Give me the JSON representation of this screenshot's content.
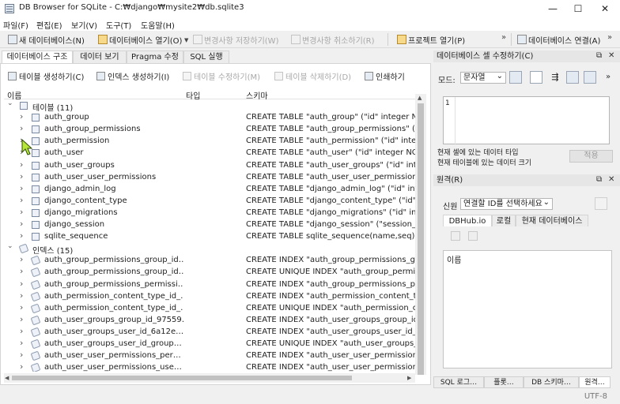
{
  "window": {
    "title": "DB Browser for SQLite - C:₩django₩mysite2₩db.sqlite3",
    "minimize": "—",
    "maximize": "☐",
    "close": "✕"
  },
  "menu": [
    "파일(F)",
    "편집(E)",
    "보기(V)",
    "도구(T)",
    "도움말(H)"
  ],
  "toolbar": {
    "new_db": "새 데이터베이스(N)",
    "open_db": "데이터베이스 열기(O)",
    "write_changes": "변경사항 저장하기(W)",
    "revert_changes": "변경사항 취소하기(R)",
    "open_project": "프로젝트 열기(P)",
    "attach_db": "데이터베이스 연결(A)",
    "more": "»"
  },
  "main_tabs": [
    "데이터베이스 구조",
    "데이터 보기",
    "Pragma 수정",
    "SQL 실행"
  ],
  "structure_toolbar": {
    "create_table": "테이블 생성하기(C)",
    "create_index": "인덱스 생성하기(I)",
    "modify_table": "테이블 수정하기(M)",
    "delete_table": "테이블 삭제하기(D)",
    "print": "인쇄하기"
  },
  "tree": {
    "headers": {
      "name": "이름",
      "type": "타입",
      "schema": "스키마"
    },
    "tables_group": "테이블 (11)",
    "tables": [
      {
        "name": "auth_group",
        "schema": "CREATE TABLE \"auth_group\" (\"id\" integer NOT N"
      },
      {
        "name": "auth_group_permissions",
        "schema": "CREATE TABLE \"auth_group_permissions\" (\"id\""
      },
      {
        "name": "auth_permission",
        "schema": "CREATE TABLE \"auth_permission\" (\"id\" integer"
      },
      {
        "name": "auth_user",
        "schema": "CREATE TABLE \"auth_user\" (\"id\" integer NOT N"
      },
      {
        "name": "auth_user_groups",
        "schema": "CREATE TABLE \"auth_user_groups\" (\"id\" integer"
      },
      {
        "name": "auth_user_user_permissions",
        "schema": "CREATE TABLE \"auth_user_user_permissions"
      },
      {
        "name": "django_admin_log",
        "schema": "CREATE TABLE \"django_admin_log\" (\"id\" integer"
      },
      {
        "name": "django_content_type",
        "schema": "CREATE TABLE \"django_content_type\" (\"id\" integer"
      },
      {
        "name": "django_migrations",
        "schema": "CREATE TABLE \"django_migrations\" (\"id\" inte"
      },
      {
        "name": "django_session",
        "schema": "CREATE TABLE \"django_session\" (\"session_ke"
      },
      {
        "name": "sqlite_sequence",
        "schema": "CREATE TABLE sqlite_sequence(name,seq)"
      }
    ],
    "indexes_group": "인덱스 (15)",
    "indexes": [
      {
        "name": "auth_group_permissions_group_id…",
        "schema": "CREATE INDEX \"auth_group_permissions_gro"
      },
      {
        "name": "auth_group_permissions_group_id…",
        "schema": "CREATE UNIQUE INDEX \"auth_group_permissi"
      },
      {
        "name": "auth_group_permissions_permissi…",
        "schema": "CREATE INDEX \"auth_group_permissions_per"
      },
      {
        "name": "auth_permission_content_type_id_…",
        "schema": "CREATE INDEX \"auth_permission_content_typ"
      },
      {
        "name": "auth_permission_content_type_id_…",
        "schema": "CREATE UNIQUE INDEX \"auth_permission_con"
      },
      {
        "name": "auth_user_groups_group_id_97559…",
        "schema": "CREATE INDEX \"auth_user_groups_group_id_"
      },
      {
        "name": "auth_user_groups_user_id_6a12e…",
        "schema": "CREATE INDEX \"auth_user_groups_user_id_6"
      },
      {
        "name": "auth_user_groups_user_id_group…",
        "schema": "CREATE UNIQUE INDEX \"auth_user_groups_us"
      },
      {
        "name": "auth_user_user_permissions_per…",
        "schema": "CREATE INDEX \"auth_user_user_permissions"
      },
      {
        "name": "auth_user_user_permissions_use…",
        "schema": "CREATE INDEX \"auth_user_user_permissions"
      }
    ]
  },
  "edit_panel": {
    "title": "데이터베이스 셀 수정하기(C)",
    "mode_label": "모드:",
    "mode_value": "문자열",
    "line_number": "1",
    "cell_type_label": "현재 셀에 있는 데이터 타입",
    "cell_size_label": "현재 테이블에 있는 데이터 크기",
    "apply": "적용"
  },
  "remote_panel": {
    "title": "원격(R)",
    "identity_label": "신원",
    "identity_value": "연결할 ID를 선택하세요",
    "tabs": [
      "DBHub.io",
      "로컬",
      "현재 데이터베이스"
    ],
    "column_name": "이름"
  },
  "bottom_tabs": [
    "SQL 로그…",
    "플롯…",
    "DB 스키마…",
    "원격…"
  ],
  "status": {
    "encoding": "UTF-8"
  },
  "panel_controls": {
    "float": "⧉",
    "close": "✕"
  }
}
